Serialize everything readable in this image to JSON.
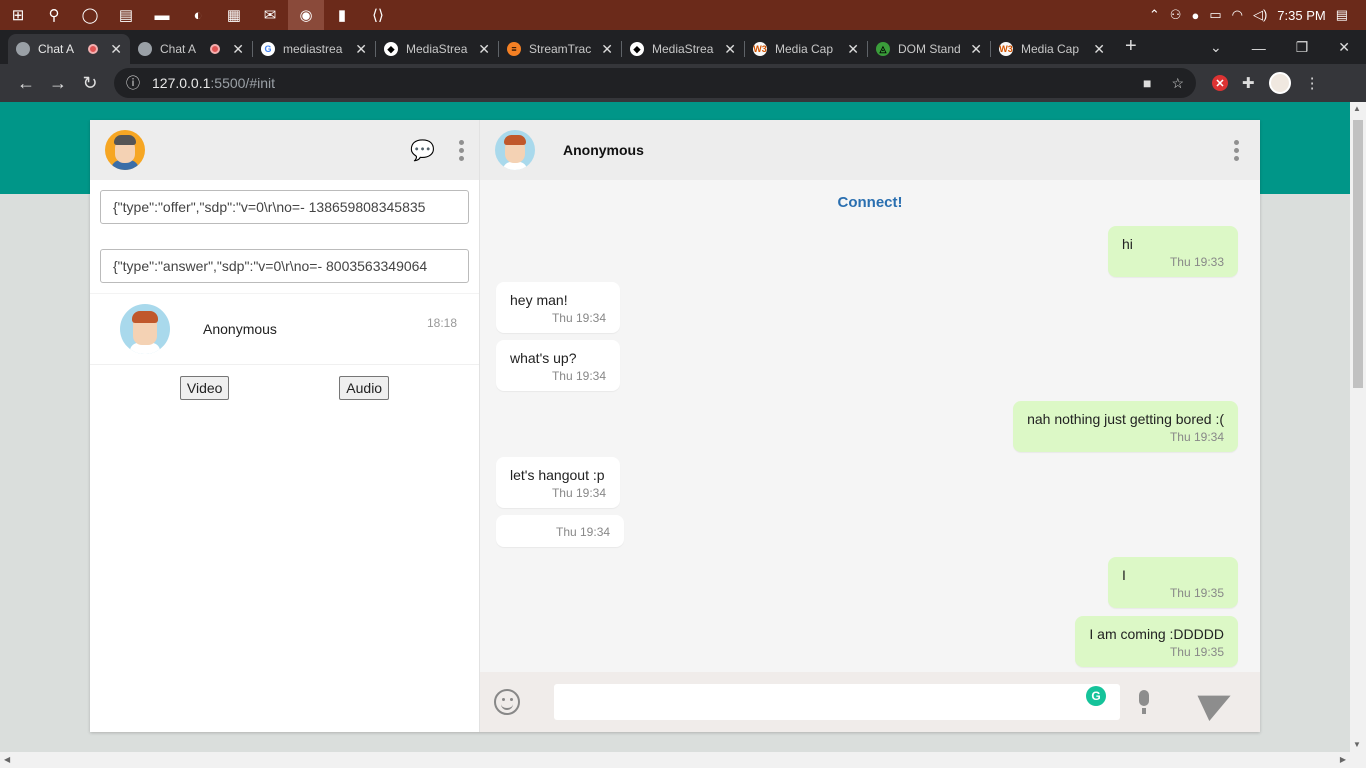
{
  "taskbar": {
    "time": "7:35 PM",
    "apps": [
      "start-icon",
      "search-icon",
      "cortana-icon",
      "task-view-icon",
      "file-explorer-icon",
      "edge-icon",
      "store-icon",
      "mail-icon",
      "chrome-icon",
      "notepad-icon",
      "vscode-icon"
    ]
  },
  "browser": {
    "tabs": [
      {
        "title": "Chat A",
        "favicon": "globe",
        "recording": true
      },
      {
        "title": "Chat A",
        "favicon": "globe",
        "recording": true
      },
      {
        "title": "mediastrea",
        "favicon": "G"
      },
      {
        "title": "MediaStrea",
        "favicon": "mdn"
      },
      {
        "title": "StreamTrac",
        "favicon": "so"
      },
      {
        "title": "MediaStrea",
        "favicon": "mdn"
      },
      {
        "title": "Media Cap",
        "favicon": "W3"
      },
      {
        "title": "DOM Stand",
        "favicon": "whatwg"
      },
      {
        "title": "Media Cap",
        "favicon": "W3"
      }
    ],
    "url_host": "127.0.0.1",
    "url_path": ":5500/#init"
  },
  "sidebar": {
    "offer_sdp": "{\"type\":\"offer\",\"sdp\":\"v=0\\r\\no=- 138659808345835",
    "answer_sdp": "{\"type\":\"answer\",\"sdp\":\"v=0\\r\\no=- 8003563349064",
    "contact": {
      "name": "Anonymous",
      "time": "18:18"
    },
    "video_label": "Video",
    "audio_label": "Audio"
  },
  "chat": {
    "contact_name": "Anonymous",
    "connect_label": "Connect!",
    "messages": [
      {
        "dir": "out",
        "text": "hi",
        "time": "Thu 19:33"
      },
      {
        "dir": "in",
        "text": "hey man!",
        "time": "Thu 19:34"
      },
      {
        "dir": "in",
        "text": "what's up?",
        "time": "Thu 19:34"
      },
      {
        "dir": "out",
        "text": "nah nothing just getting bored :(",
        "time": "Thu 19:34"
      },
      {
        "dir": "in",
        "text": "let's hangout :p",
        "time": "Thu 19:34"
      },
      {
        "dir": "in",
        "text": "",
        "time": "Thu 19:34"
      },
      {
        "dir": "out",
        "text": "I",
        "time": "Thu 19:35"
      },
      {
        "dir": "out",
        "text": "I am coming :DDDDD",
        "time": "Thu 19:35"
      }
    ]
  },
  "colors": {
    "header_band": "#009688",
    "outgoing_bubble": "#dcf8c6",
    "connect_link": "#2a6fb0"
  }
}
